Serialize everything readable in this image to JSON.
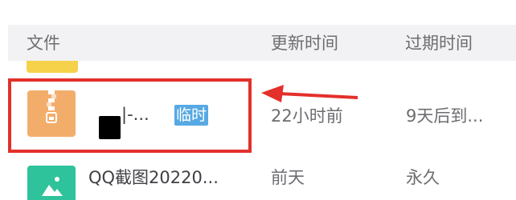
{
  "header": {
    "file_label": "文件",
    "updated_label": "更新时间",
    "expiry_label": "过期时间"
  },
  "rows": [
    {
      "icon": "zip-file-icon",
      "name": "|-...",
      "badge": "临时",
      "updated": "22小时前",
      "expiry": "9天后到..."
    },
    {
      "icon": "image-file-icon",
      "name": "QQ截图20220...",
      "updated": "前天",
      "expiry": "永久"
    }
  ],
  "colors": {
    "highlight": "#e3302a",
    "badge": "#57a9e3",
    "zip_icon": "#f3ad6b",
    "image_icon": "#2ec39a",
    "partial_icon": "#f6d24a"
  }
}
